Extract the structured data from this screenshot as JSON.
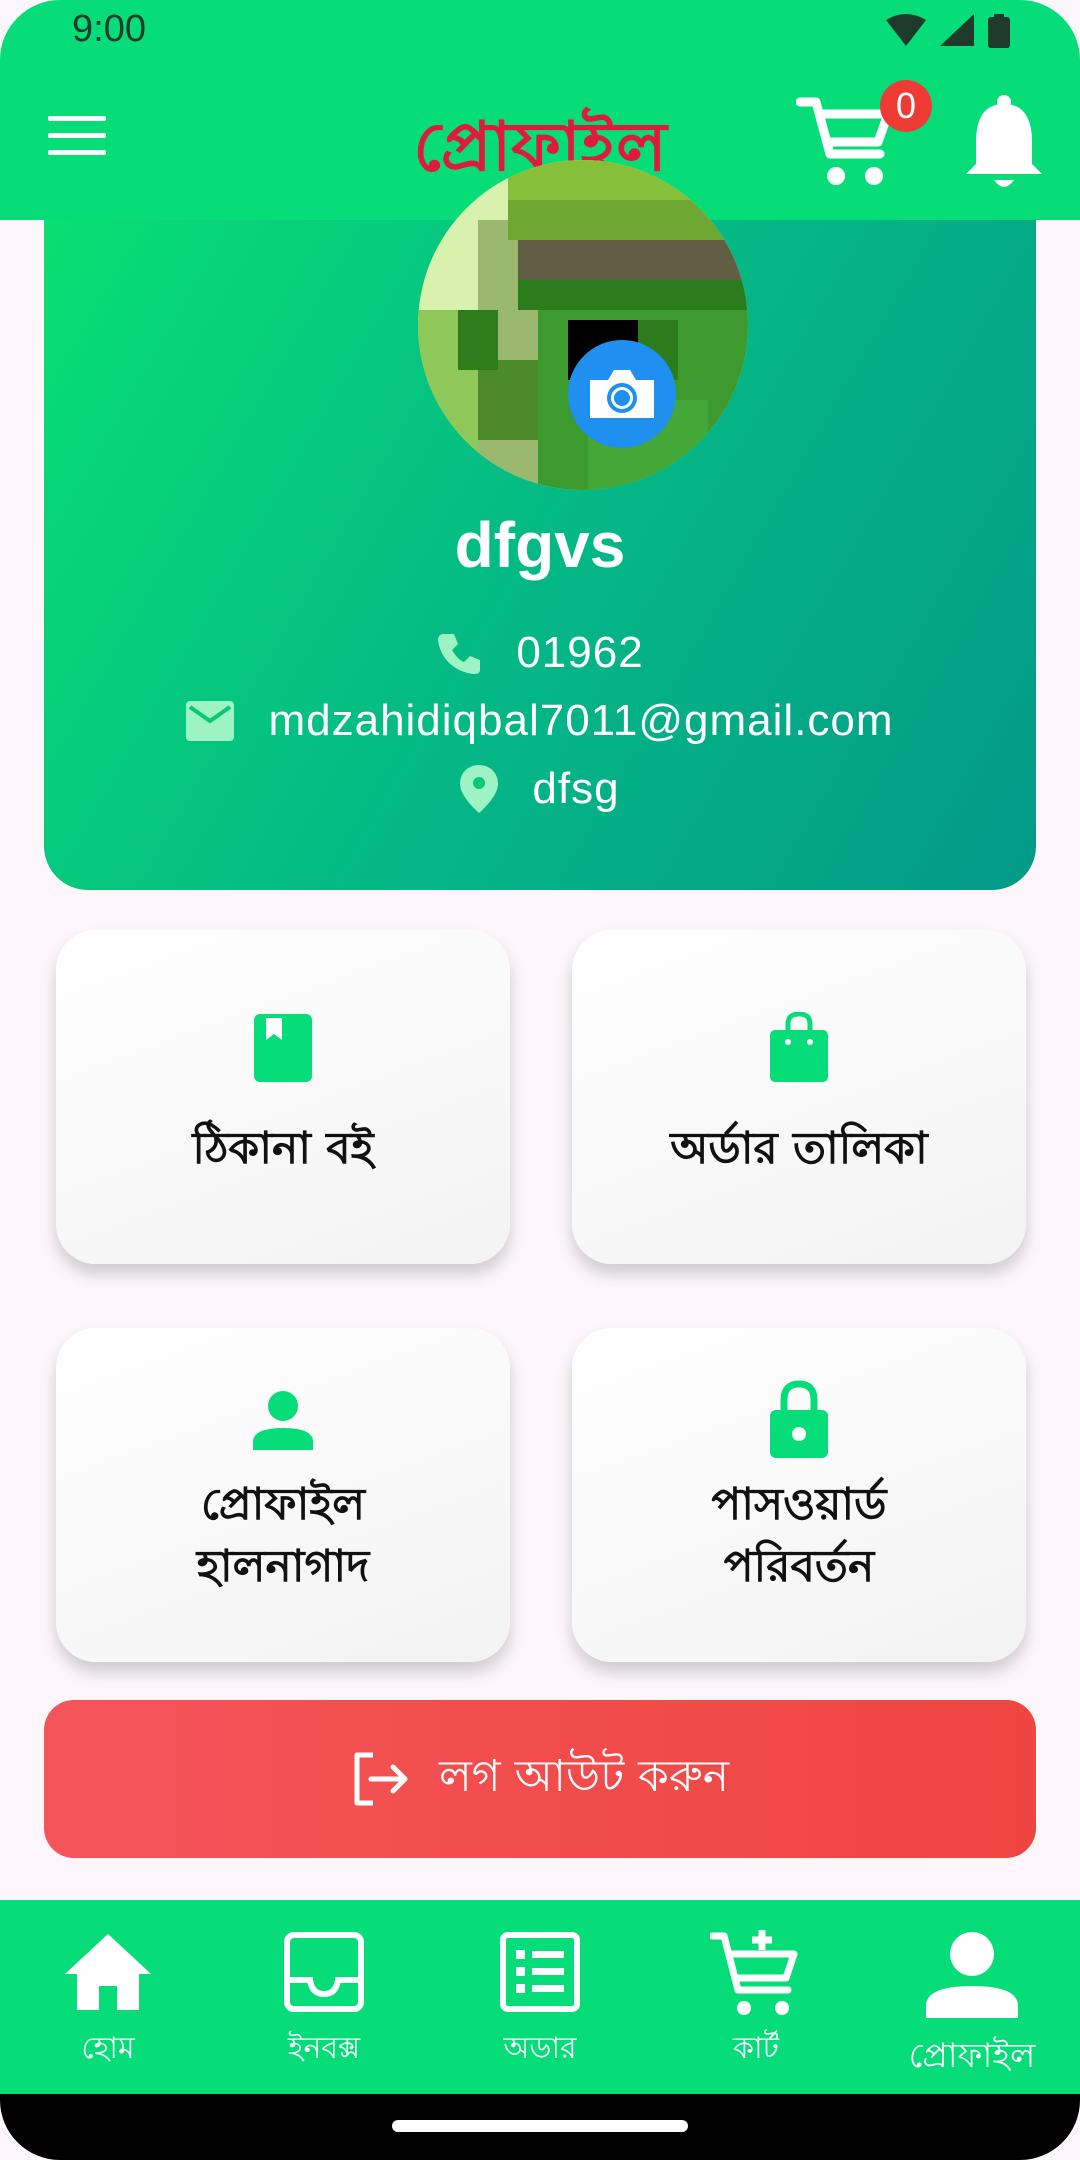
{
  "status_bar": {
    "time": "9:00"
  },
  "app_bar": {
    "title": "প্রোফাইল",
    "cart_count": "0"
  },
  "profile": {
    "name": "dfgvs",
    "phone": "01962",
    "email": "mdzahidiqbal7011@gmail.com",
    "address": "dfsg"
  },
  "tiles": [
    {
      "label": "ঠিকানা বই",
      "icon": "address-book-icon"
    },
    {
      "label": "অর্ডার তালিকা",
      "icon": "shopping-bag-icon"
    },
    {
      "label_line1": "প্রোফাইল",
      "label_line2": "হালনাগাদ",
      "icon": "person-icon"
    },
    {
      "label_line1": "পাসওয়ার্ড",
      "label_line2": "পরিবর্তন",
      "icon": "lock-icon"
    }
  ],
  "logout": {
    "label": "লগ আউট করুন"
  },
  "bottom_nav": [
    {
      "label": "হোম",
      "icon": "home-icon"
    },
    {
      "label": "ইনবক্স",
      "icon": "inbox-icon"
    },
    {
      "label": "অডার",
      "icon": "list-icon"
    },
    {
      "label": "কার্ট",
      "icon": "add-cart-icon"
    },
    {
      "label": "প্রোফাইল",
      "icon": "person-icon",
      "active": true
    }
  ],
  "colors": {
    "primary": "#06dd78",
    "title_red": "#e01a3c",
    "logout_red": "#f04848",
    "camera_blue": "#1f8ff0",
    "badge_red": "#ee3b34"
  }
}
